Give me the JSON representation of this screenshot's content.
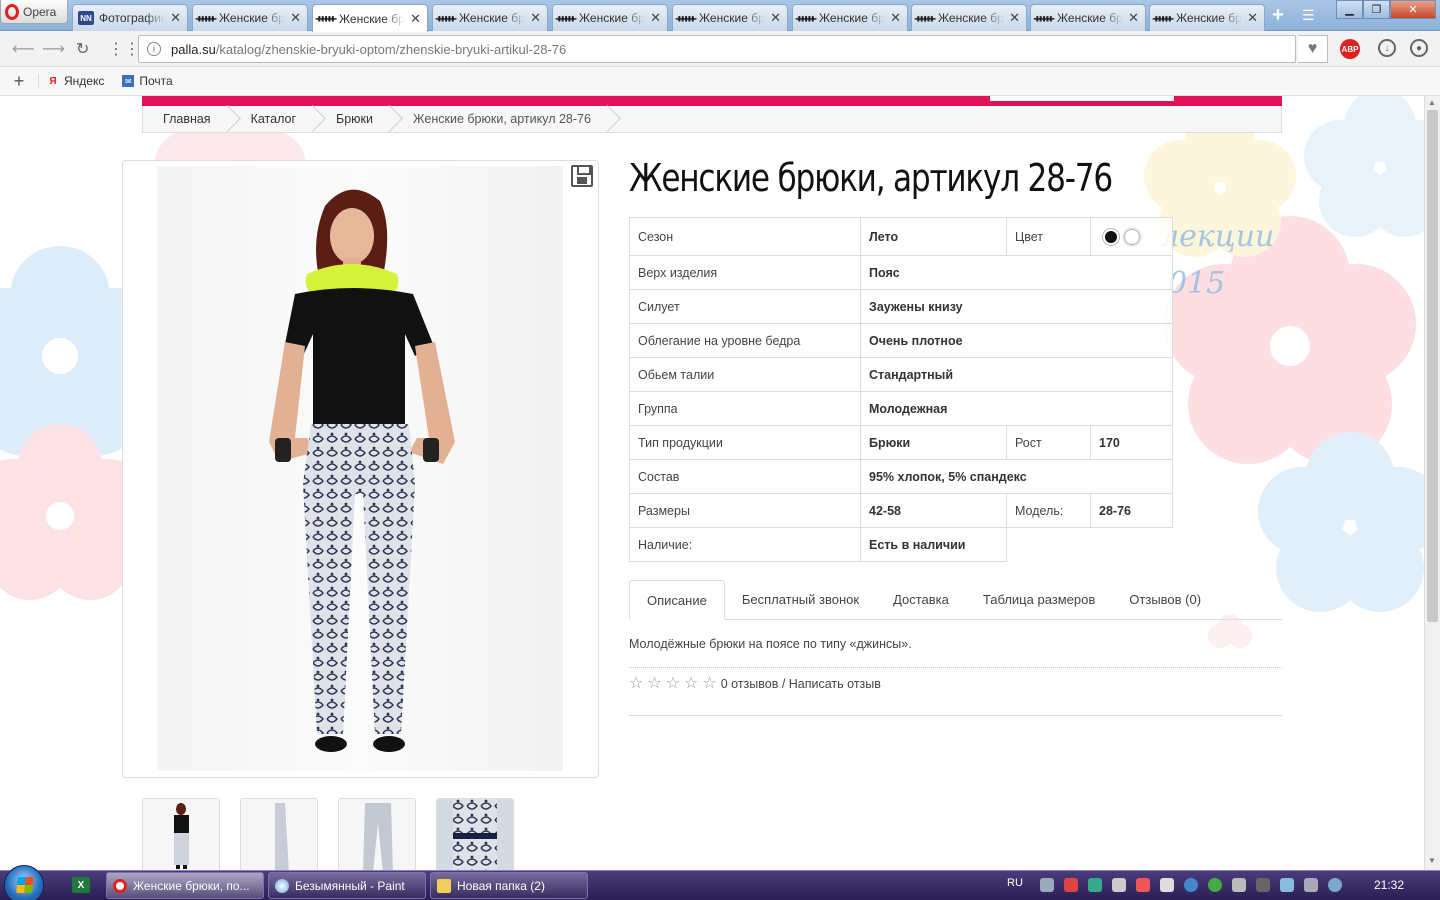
{
  "browser": {
    "menu_label": "Opera",
    "tabs": [
      {
        "title": "Фотографии",
        "icon": "nn-icon"
      },
      {
        "title": "Женские брюки",
        "icon": "palla-icon"
      },
      {
        "title": "Женские брюки",
        "icon": "palla-icon",
        "active": true
      },
      {
        "title": "Женские брюки",
        "icon": "palla-icon"
      },
      {
        "title": "Женские брюки",
        "icon": "palla-icon"
      },
      {
        "title": "Женские брюки",
        "icon": "palla-icon"
      },
      {
        "title": "Женские брюки",
        "icon": "palla-icon"
      },
      {
        "title": "Женские брюки",
        "icon": "palla-icon"
      },
      {
        "title": "Женские брюки",
        "icon": "palla-icon"
      },
      {
        "title": "Женские брюки",
        "icon": "palla-icon"
      }
    ],
    "url_host": "palla.su",
    "url_path": "/katalog/zhenskie-bryuki-optom/zhenskie-bryuki-artikul-28-76",
    "abp_label": "ABP",
    "bookmarks": [
      {
        "label": "Яндекс",
        "icon": "yandex-icon"
      },
      {
        "label": "Почта",
        "icon": "mail-icon"
      }
    ]
  },
  "page": {
    "breadcrumbs": [
      "Главная",
      "Каталог",
      "Брюки",
      "Женские брюки, артикул 28-76"
    ],
    "title": "Женские брюки, артикул 28-76",
    "collection_text": "лекции",
    "collection_year": "015",
    "attributes": {
      "season_label": "Сезон",
      "season_value": "Лето",
      "color_label": "Цвет",
      "top_label": "Верх изделия",
      "top_value": "Пояс",
      "silhouette_label": "Силует",
      "silhouette_value": "Заужены книзу",
      "fit_label": "Облегание на уровне бедра",
      "fit_value": "Очень плотное",
      "waist_label": "Обьем талии",
      "waist_value": "Стандартный",
      "group_label": "Группа",
      "group_value": "Молодежная",
      "type_label": "Тип продукции",
      "type_value": "Брюки",
      "height_label": "Рост",
      "height_value": "170",
      "composition_label": "Состав",
      "composition_value": "95% хлопок, 5% спандекс",
      "sizes_label": "Размеры",
      "sizes_value": "42-58",
      "model_label": "Модель:",
      "model_value": "28-76",
      "availability_label": "Наличие:",
      "availability_value": "Есть в наличии"
    },
    "colors": [
      "#111111",
      "#ffffff"
    ],
    "tabs": [
      "Описание",
      "Бесплатный звонок",
      "Доставка",
      "Таблица размеров",
      "Отзывов (0)"
    ],
    "description": "Молодёжные брюки на поясе по типу «джинсы».",
    "rating": {
      "stars": 0,
      "max": 5,
      "text": "0 отзывов / Написать отзыв"
    }
  },
  "taskbar": {
    "tasks": [
      {
        "label": "Женские брюки, по...",
        "icon": "opera-icon",
        "active": true
      },
      {
        "label": "Безымянный - Paint",
        "icon": "paint-icon"
      },
      {
        "label": "Новая папка (2)",
        "icon": "folder-icon"
      }
    ],
    "lang": "RU",
    "time": "21:32"
  },
  "colors": {
    "accent": "#e0125a",
    "taskbar": "#3a2d6a"
  }
}
